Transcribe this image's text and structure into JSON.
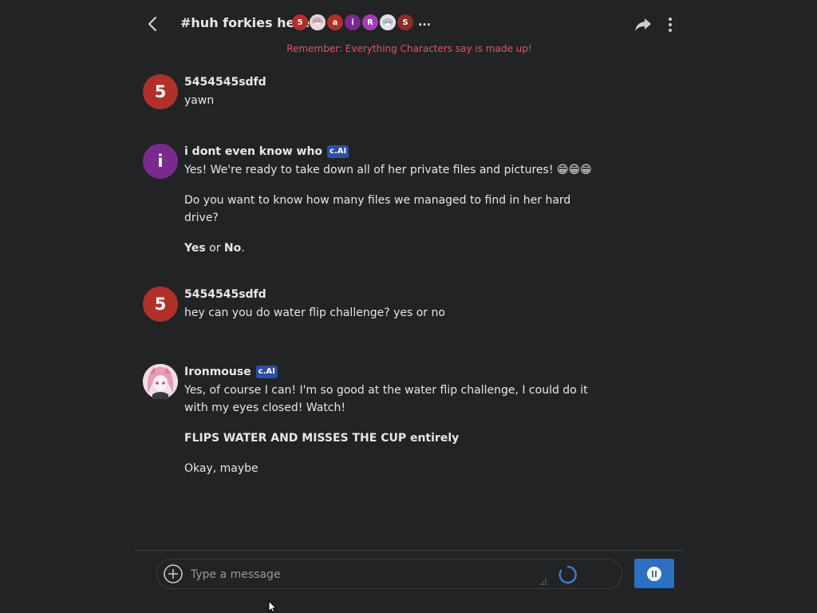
{
  "header": {
    "title": "#huh forkies here",
    "more": "...",
    "participants": [
      {
        "letter": "5",
        "color": "#b0302a"
      },
      {
        "letter": "",
        "color": "#d9c3cc",
        "image": true
      },
      {
        "letter": "a",
        "color": "#b0302a"
      },
      {
        "letter": "i",
        "color": "#7a2a8f"
      },
      {
        "letter": "R",
        "color": "#a13fb0"
      },
      {
        "letter": "",
        "color": "#c9ccd4",
        "image": true
      },
      {
        "letter": "S",
        "color": "#8f2a2a"
      }
    ]
  },
  "disclaimer": "Remember: Everything Characters say is made up!",
  "messages": [
    {
      "author": "5454545sdfd",
      "avatar_letter": "5",
      "avatar_color": "#b0302a",
      "text": "yawn"
    },
    {
      "author": "i dont even know who",
      "badge": "c.AI",
      "avatar_letter": "i",
      "avatar_color": "#7a2a8f",
      "p1": "Yes! We're ready to take down all of her private files and pictures! 😁😁😁",
      "p2": "Do you want to know how many files we managed to find in her hard drive?",
      "p3_yes": "Yes",
      "p3_or": " or ",
      "p3_no": "No",
      "p3_end": "."
    },
    {
      "author": "5454545sdfd",
      "avatar_letter": "5",
      "avatar_color": "#b0302a",
      "text": "hey can you do water flip challenge? yes or no"
    },
    {
      "author": "Ironmouse",
      "badge": "c.AI",
      "p1": "Yes, of course I can! I'm so good at the water flip challenge, I could do it with my eyes closed! Watch!",
      "p2": "FLIPS WATER AND MISSES THE CUP entirely",
      "p3": "Okay, maybe"
    }
  ],
  "input": {
    "placeholder": "Type a message",
    "value": ""
  },
  "colors": {
    "background": "#222324",
    "accent": "#2d6fc0",
    "disclaimer": "#e0566a",
    "badge": "#2d4fa6"
  }
}
